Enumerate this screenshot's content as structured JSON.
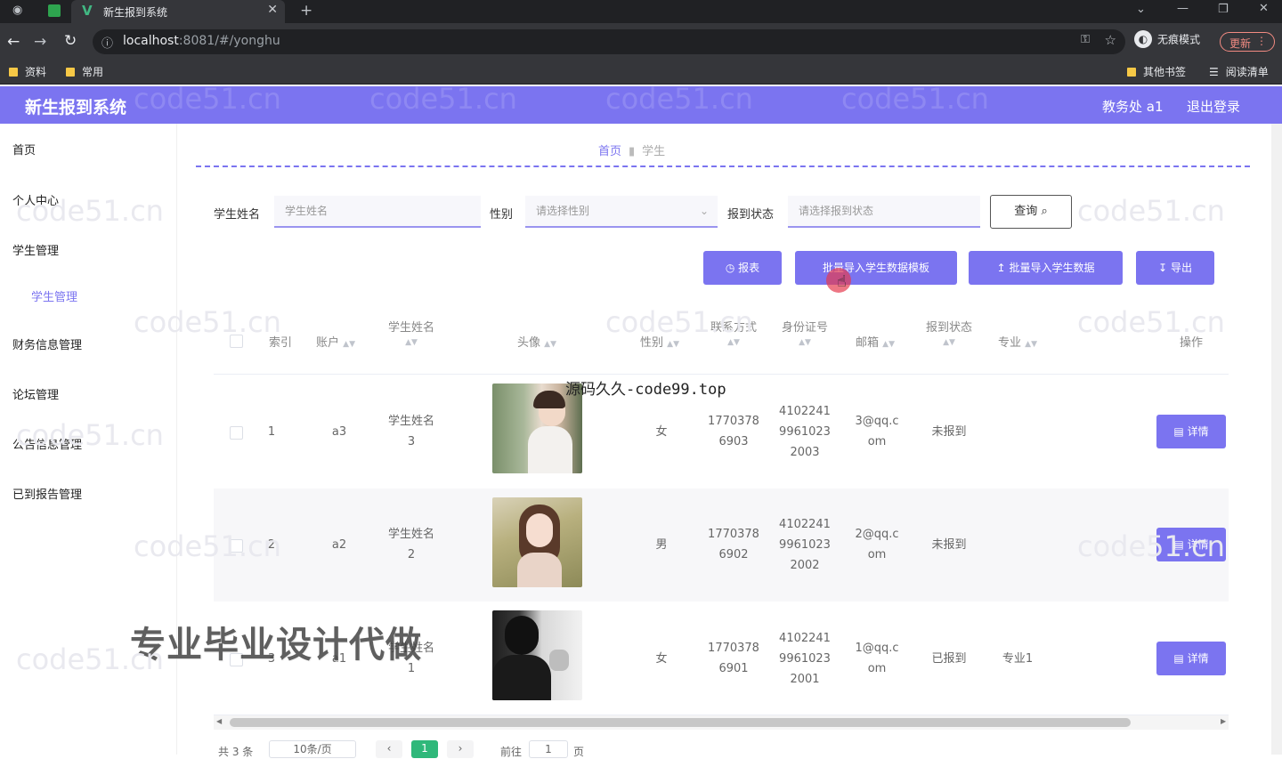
{
  "browser": {
    "tab_title": "新生报到系统",
    "url_host": "localhost",
    "url_rest": ":8081/#/yonghu",
    "incognito_label": "无痕模式",
    "update_label": "更新",
    "bookmarks": [
      "资料",
      "常用"
    ],
    "bookmarks_right": [
      "其他书签",
      "阅读清单"
    ]
  },
  "header": {
    "brand": "新生报到系统",
    "user_label": "教务处 a1",
    "logout_label": "退出登录",
    "accent": "#7b74f0"
  },
  "sidebar": {
    "items": [
      {
        "label": "首页"
      },
      {
        "label": "个人中心"
      },
      {
        "label": "学生管理"
      },
      {
        "label": "学生管理"
      },
      {
        "label": "财务信息管理"
      },
      {
        "label": "论坛管理"
      },
      {
        "label": "公告信息管理"
      },
      {
        "label": "已到报告管理"
      }
    ]
  },
  "breadcrumb": {
    "home": "首页",
    "current": "学生"
  },
  "filters": {
    "name_label": "学生姓名",
    "name_placeholder": "学生姓名",
    "gender_label": "性别",
    "gender_placeholder": "请选择性别",
    "status_label": "报到状态",
    "status_placeholder": "请选择报到状态",
    "query_label": "查询"
  },
  "actions": {
    "report": "报表",
    "template": "批量导入学生数据模板",
    "import": "批量导入学生数据",
    "export": "导出"
  },
  "table": {
    "headers": [
      "索引",
      "账户",
      "学生姓名",
      "头像",
      "性别",
      "联系方式",
      "身份证号",
      "邮箱",
      "报到状态",
      "专业",
      "操作"
    ],
    "rows": [
      {
        "index": "1",
        "account": "a3",
        "name_l1": "学生姓名",
        "name_l2": "3",
        "gender": "女",
        "phone_l1": "1770378",
        "phone_l2": "6903",
        "id_l1": "4102241",
        "id_l2": "9961023",
        "id_l3": "2003",
        "email_l1": "3@qq.c",
        "email_l2": "om",
        "status": "未报到",
        "major": "",
        "action": "详情"
      },
      {
        "index": "2",
        "account": "a2",
        "name_l1": "学生姓名",
        "name_l2": "2",
        "gender": "男",
        "phone_l1": "1770378",
        "phone_l2": "6902",
        "id_l1": "4102241",
        "id_l2": "9961023",
        "id_l3": "2002",
        "email_l1": "2@qq.c",
        "email_l2": "om",
        "status": "未报到",
        "major": "",
        "action": "详情"
      },
      {
        "index": "3",
        "account": "a1",
        "name_l1": "学生姓名",
        "name_l2": "1",
        "gender": "女",
        "phone_l1": "1770378",
        "phone_l2": "6901",
        "id_l1": "4102241",
        "id_l2": "9961023",
        "id_l3": "2001",
        "email_l1": "1@qq.c",
        "email_l2": "om",
        "status": "已报到",
        "major": "专业1",
        "action": "详情"
      }
    ]
  },
  "pagination": {
    "total": "共 3 条",
    "page_size": "10条/页",
    "current_page": "1",
    "goto_label": "前往",
    "goto_value": "1",
    "page_unit": "页"
  },
  "overlay": {
    "ad_text": "专业毕业设计代做",
    "source_text": "源码久久-code99.top",
    "watermark": "code51.cn"
  }
}
